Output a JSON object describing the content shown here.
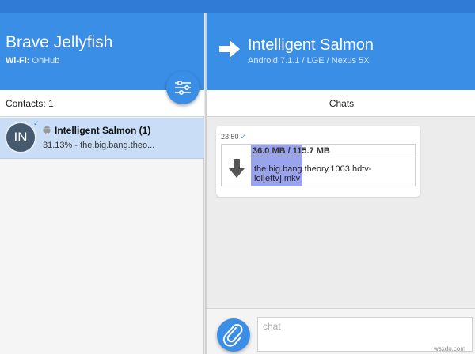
{
  "left": {
    "device_name": "Brave Jellyfish",
    "wifi_label": "Wi-Fi:",
    "wifi_network": "OnHub",
    "contacts_label": "Contacts: 1"
  },
  "contact": {
    "initials": "IN",
    "name": "Intelligent Salmon (1)",
    "status": "31.13% - the.big.bang.theo..."
  },
  "right": {
    "peer_name": "Intelligent Salmon",
    "peer_info": "Android 7.1.1 / LGE / Nexus 5X",
    "chats_title": "Chats"
  },
  "message": {
    "time": "23:50",
    "check": "✓",
    "file_size": "36.0 MB / 115.7 MB",
    "file_name": "the.big.bang.theory.1003.hdtv-lol[ettv].mkv",
    "progress_fraction": 0.3113
  },
  "compose": {
    "placeholder": "chat"
  },
  "watermark": "wsxdn.com",
  "icons": {
    "settings": "sliders-icon",
    "send": "arrow-right-icon",
    "download": "download-arrow-icon",
    "attach": "paperclip-icon",
    "android": "android-icon"
  },
  "colors": {
    "accent": "#3a8ee6",
    "selected_row": "#c9def6",
    "progress": "#9aa3ee"
  }
}
